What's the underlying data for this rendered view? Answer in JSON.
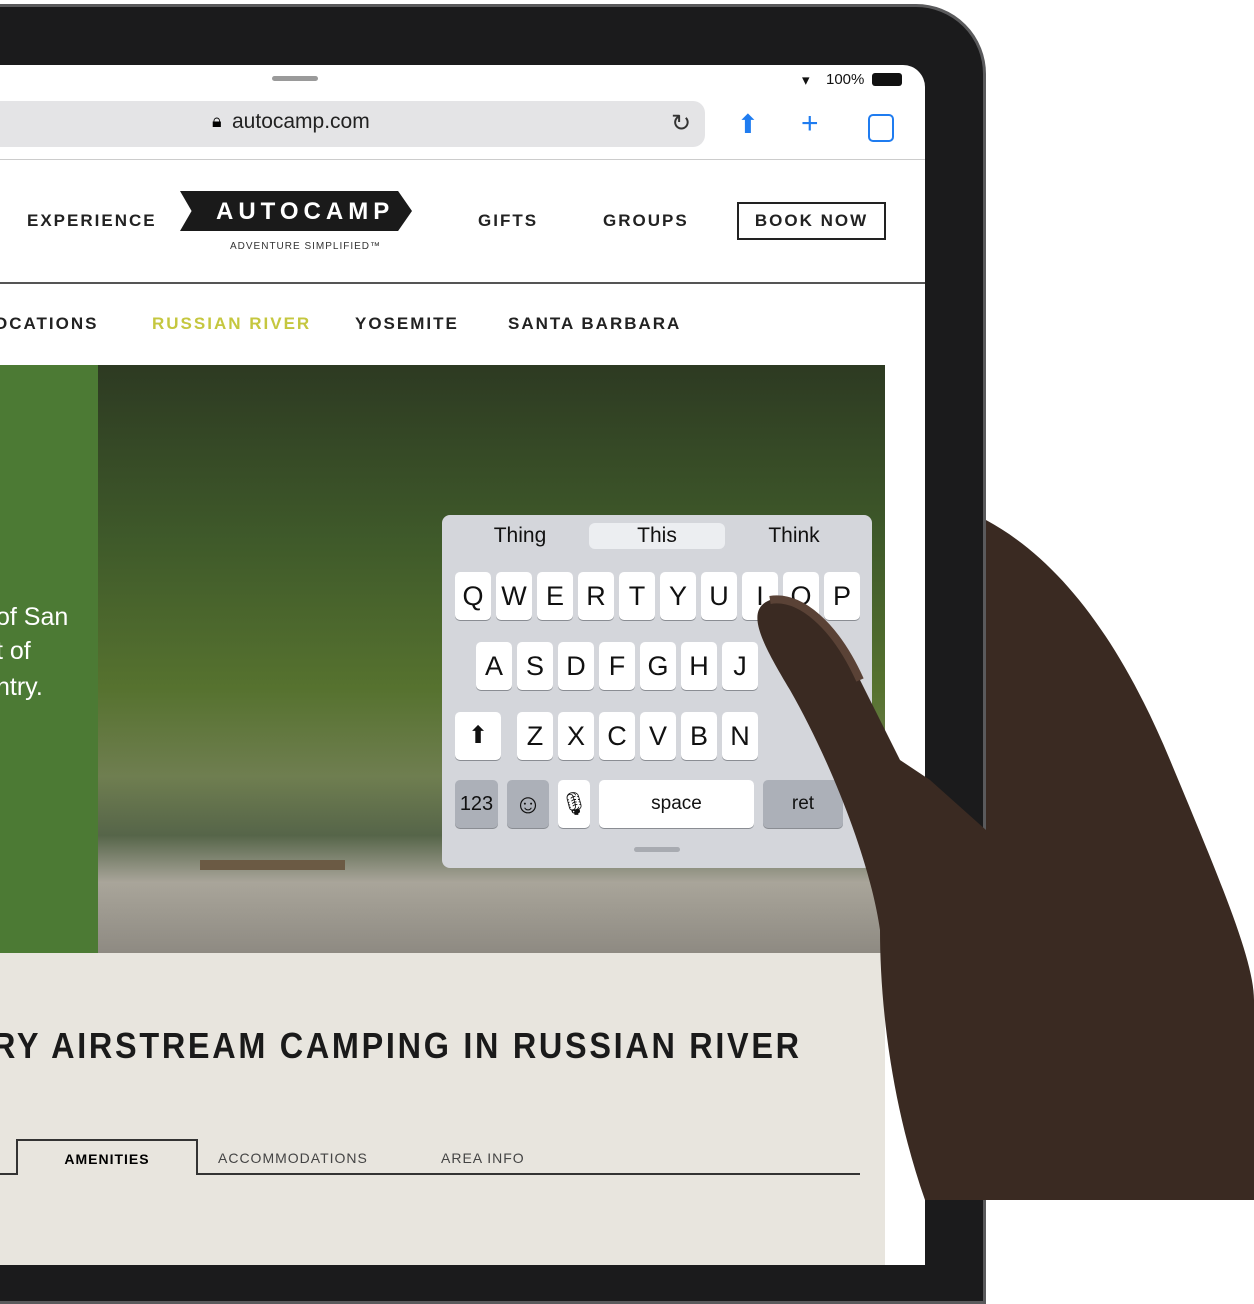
{
  "status": {
    "battery": "100%",
    "icons": [
      "wifi-icon",
      "battery-icon"
    ]
  },
  "browser": {
    "url": "autocamp.com",
    "icons": [
      "lock-icon",
      "reload-icon",
      "share-icon",
      "new-tab-icon",
      "tabs-icon"
    ]
  },
  "site": {
    "nav": [
      "EXPERIENCE",
      "GIFTS",
      "GROUPS"
    ],
    "book_now": "BOOK NOW",
    "logo": "AUTOCAMP",
    "tagline": "ADVENTURE SIMPLIFIED™",
    "locations": [
      "OCATIONS",
      "RUSSIAN RIVER",
      "YOSEMITE",
      "SANTA BARBARA"
    ],
    "active_location_color": "#c5c73f",
    "panel_text": [
      "of San",
      "t of",
      "ntry."
    ],
    "heading": "RY AIRSTREAM CAMPING IN RUSSIAN RIVER",
    "tabs": [
      "AMENITIES",
      "ACCOMMODATIONS",
      "AREA INFO"
    ]
  },
  "keyboard": {
    "suggestions": [
      "Thing",
      "This",
      "Think"
    ],
    "row1": [
      "Q",
      "W",
      "E",
      "R",
      "T",
      "Y",
      "U",
      "I",
      "O",
      "P"
    ],
    "row2": [
      "A",
      "S",
      "D",
      "F",
      "G",
      "H",
      "J"
    ],
    "row3": [
      "Z",
      "X",
      "C",
      "V",
      "B",
      "N"
    ],
    "numbers": "123",
    "space": "space",
    "return": "ret"
  }
}
